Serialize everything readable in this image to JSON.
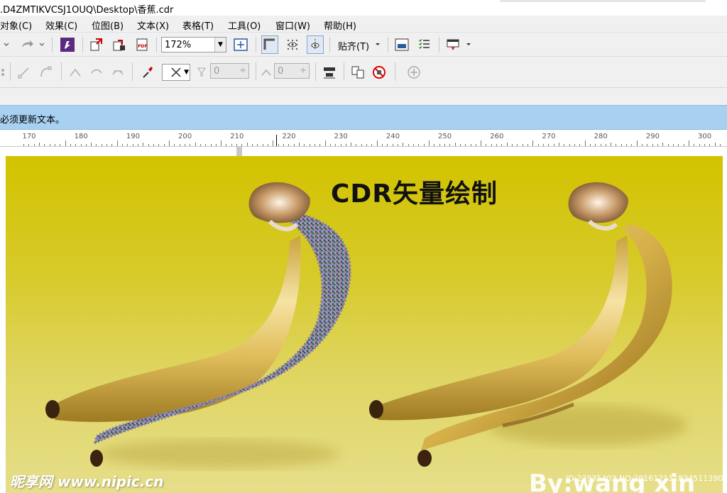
{
  "window": {
    "title": ".D4ZMTIKVCSJ1OUQ\\Desktop\\香蕉.cdr"
  },
  "menu": [
    "对象(C)",
    "效果(C)",
    "位图(B)",
    "文本(X)",
    "表格(T)",
    "工具(O)",
    "窗口(W)",
    "帮助(H)"
  ],
  "toolbar": {
    "zoom_value": "172%",
    "snap_label": "贴齐(T)"
  },
  "property_bar": {
    "outline_value": "0",
    "angle_value": "0"
  },
  "info_bar": {
    "message": "必须更新文本。"
  },
  "ruler": {
    "labels": [
      "170",
      "180",
      "190",
      "200",
      "210",
      "220",
      "230",
      "240",
      "250",
      "260",
      "270",
      "280",
      "290",
      "300"
    ]
  },
  "canvas": {
    "artwork_title": "CDR矢量绘制",
    "watermark_site": "昵享网 www.nipic.cn",
    "watermark_id": "ID:23935403 NO:20161211183451139031",
    "watermark_author": "By:wang xin"
  },
  "colors": {
    "info_bar": "#a8d0f0",
    "artboard_top": "#d2c300",
    "artboard_bottom": "#e6de8a",
    "banana_body": "#e2c25a",
    "banana_stem": "#8a6a40"
  }
}
